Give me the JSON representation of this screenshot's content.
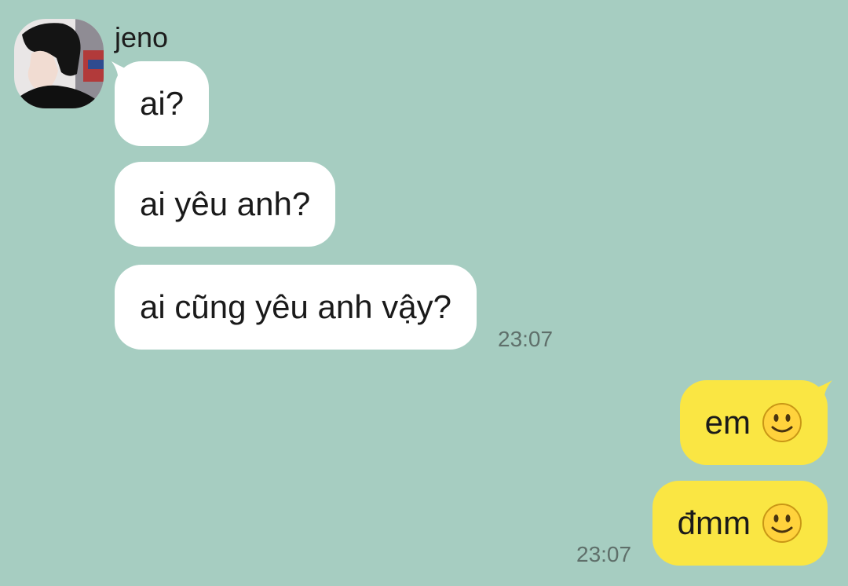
{
  "contact": {
    "name": "jeno",
    "avatar_icon": "profile-photo"
  },
  "incoming": {
    "messages": [
      {
        "text": "ai?"
      },
      {
        "text": "ai yêu anh?"
      },
      {
        "text": "ai cũng yêu anh vậy?"
      }
    ],
    "time": "23:07"
  },
  "outgoing": {
    "messages": [
      {
        "text": "em",
        "emoji": "slightly-smiling-face"
      },
      {
        "text": "đmm",
        "emoji": "slightly-smiling-face"
      }
    ],
    "time": "23:07"
  },
  "colors": {
    "background": "#a6cdc1",
    "incoming_bubble": "#ffffff",
    "outgoing_bubble": "#fae643"
  }
}
